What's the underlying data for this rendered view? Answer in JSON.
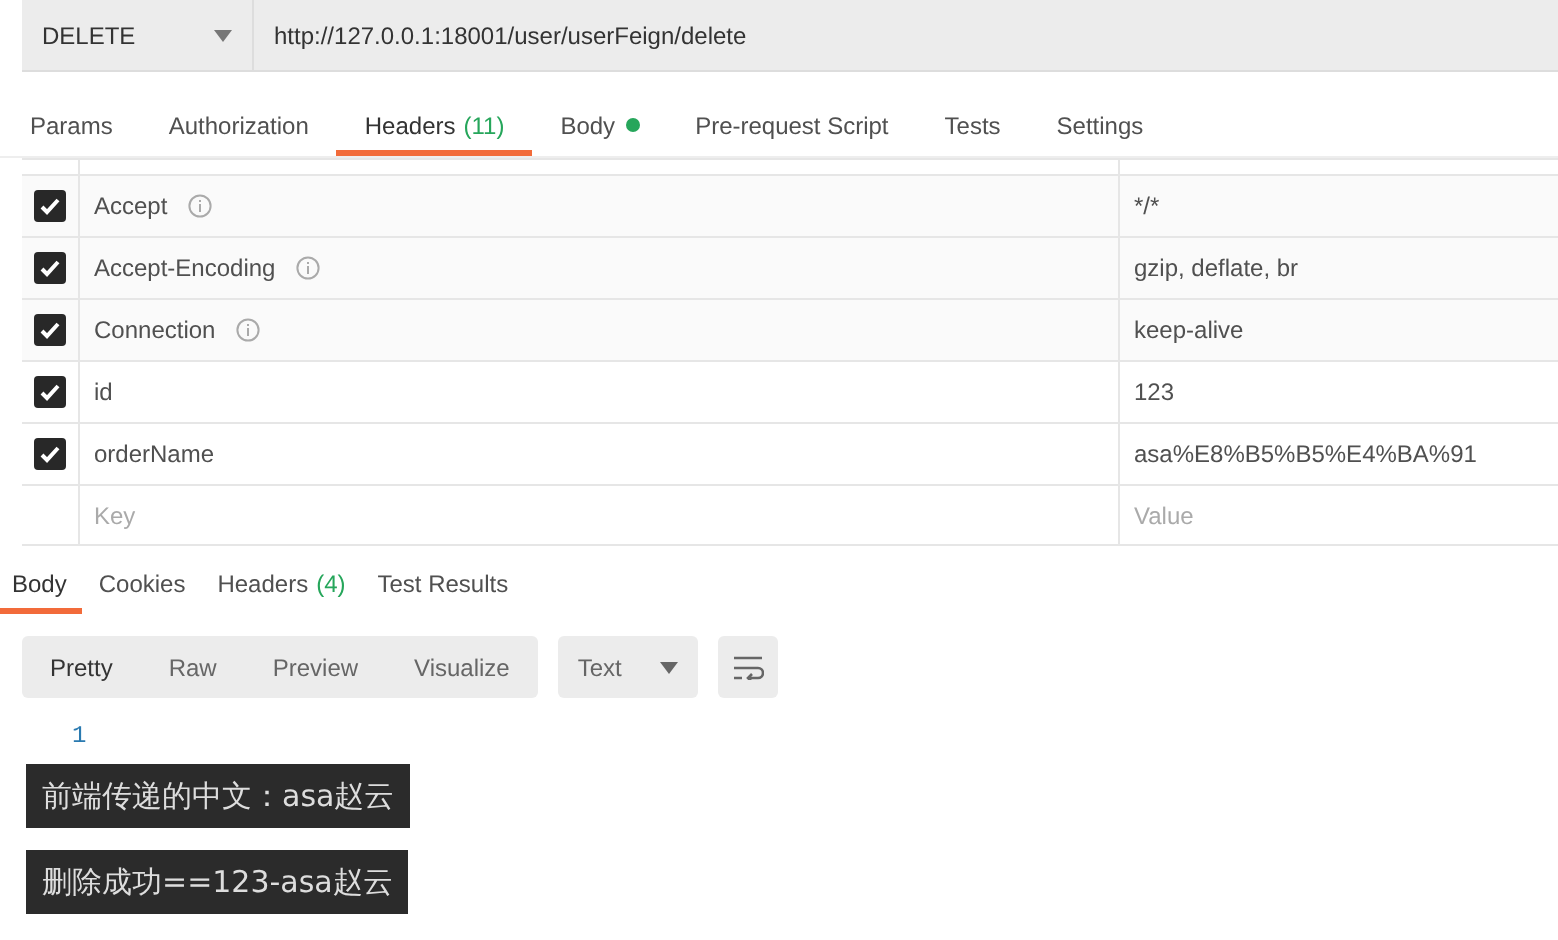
{
  "request": {
    "method": "DELETE",
    "url": "http://127.0.0.1:18001/user/userFeign/delete"
  },
  "request_tabs": [
    {
      "label": "Params",
      "selected": false
    },
    {
      "label": "Authorization",
      "selected": false
    },
    {
      "label": "Headers",
      "count": "(11)",
      "selected": true
    },
    {
      "label": "Body",
      "dot": true,
      "selected": false
    },
    {
      "label": "Pre-request Script",
      "selected": false
    },
    {
      "label": "Tests",
      "selected": false
    },
    {
      "label": "Settings",
      "selected": false
    }
  ],
  "headers": [
    {
      "key": "Accept",
      "info": true,
      "value": "*/*",
      "checked": true
    },
    {
      "key": "Accept-Encoding",
      "info": true,
      "value": "gzip, deflate, br",
      "checked": true
    },
    {
      "key": "Connection",
      "info": true,
      "value": "keep-alive",
      "checked": true
    },
    {
      "key": "id",
      "info": false,
      "value": "123",
      "checked": true
    },
    {
      "key": "orderName",
      "info": false,
      "value": "asa%E8%B5%B5%E4%BA%91",
      "checked": true
    }
  ],
  "new_header": {
    "key_placeholder": "Key",
    "value_placeholder": "Value"
  },
  "response_tabs": [
    {
      "label": "Body",
      "selected": true
    },
    {
      "label": "Cookies",
      "selected": false
    },
    {
      "label": "Headers",
      "count": "(4)",
      "selected": false
    },
    {
      "label": "Test Results",
      "selected": false
    }
  ],
  "view_modes": [
    {
      "label": "Pretty",
      "selected": true
    },
    {
      "label": "Raw",
      "selected": false
    },
    {
      "label": "Preview",
      "selected": false
    },
    {
      "label": "Visualize",
      "selected": false
    }
  ],
  "format": "Text",
  "line_numbers": [
    "1"
  ],
  "console_lines": [
    "前端传递的中文：asa赵云",
    "删除成功==123-asa赵云"
  ]
}
